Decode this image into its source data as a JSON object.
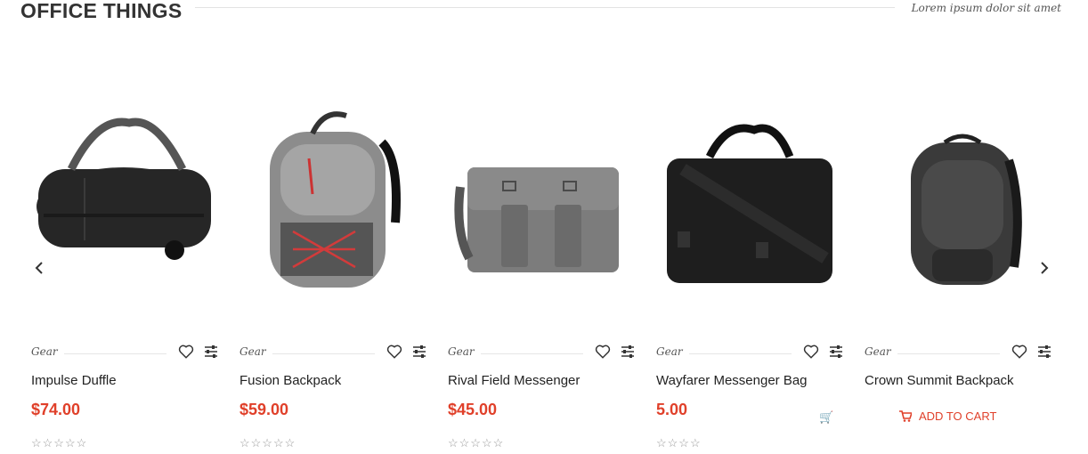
{
  "section": {
    "title": "OFFICE THINGS",
    "subtitle": "Lorem ipsum dolor sit amet"
  },
  "colors": {
    "accent": "#e0402a",
    "text": "#222222",
    "muted": "#999999"
  },
  "products": [
    {
      "category": "Gear",
      "name": "Impulse Duffle",
      "price": "$74.00",
      "stars": "☆☆☆☆☆"
    },
    {
      "category": "Gear",
      "name": "Fusion Backpack",
      "price": "$59.00",
      "stars": "☆☆☆☆☆"
    },
    {
      "category": "Gear",
      "name": "Rival Field Messenger",
      "price": "$45.00",
      "stars": "☆☆☆☆☆"
    },
    {
      "category": "Gear",
      "name": "Wayfarer Messenger Bag",
      "price": "5.00",
      "stars": "☆☆☆☆"
    },
    {
      "category": "Gear",
      "name": "Crown Summit Backpack"
    }
  ],
  "add_to_cart": {
    "label": "ADD TO CART",
    "icon": "cart-icon"
  },
  "icons": {
    "prev": "chevron-left-icon",
    "next": "chevron-right-icon",
    "wishlist": "heart-icon",
    "compare": "sliders-icon"
  }
}
